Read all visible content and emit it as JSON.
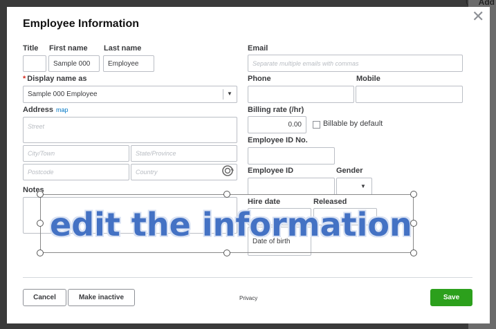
{
  "backdrop": {
    "add_text": "Add",
    "paren": "("
  },
  "dialog": {
    "title": "Employee Information",
    "close_glyph": "✕",
    "left": {
      "title_label": "Title",
      "title_value": "",
      "first_name_label": "First name",
      "first_name_value": "Sample 000",
      "last_name_label": "Last name",
      "last_name_value": "Employee",
      "display_name_label": "Display name as",
      "display_name_required": "*",
      "display_name_value": "Sample 000 Employee",
      "address_label": "Address",
      "map_link": "map",
      "street_placeholder": "Street",
      "city_placeholder": "City/Town",
      "state_placeholder": "State/Province",
      "postcode_placeholder": "Postcode",
      "country_placeholder": "Country",
      "notes_label": "Notes",
      "notes_value": ""
    },
    "right": {
      "email_label": "Email",
      "email_placeholder": "Separate multiple emails with commas",
      "phone_label": "Phone",
      "mobile_label": "Mobile",
      "billing_rate_label": "Billing rate (/hr)",
      "billing_rate_value": "0.00",
      "billable_label": "Billable by default",
      "billable_checked": false,
      "employee_id_no_label": "Employee ID No.",
      "employee_id_label": "Employee ID",
      "gender_label": "Gender",
      "gender_value": "",
      "hire_date_label": "Hire date",
      "released_label": "Released",
      "date_of_birth_partial": "Date of birth"
    },
    "footer": {
      "cancel_label": "Cancel",
      "make_inactive_label": "Make inactive",
      "privacy_label": "Privacy",
      "save_label": "Save"
    }
  },
  "overlay": {
    "text": "edit the information"
  },
  "colors": {
    "accent_green": "#2ca01c",
    "link_blue": "#0077c5",
    "required_red": "#d52b1e",
    "overlay_blue": "#4472c4"
  },
  "icons": {
    "close": "close-icon",
    "dropdown": "chevron-down-icon",
    "rotate": "rotate-handle-icon"
  }
}
